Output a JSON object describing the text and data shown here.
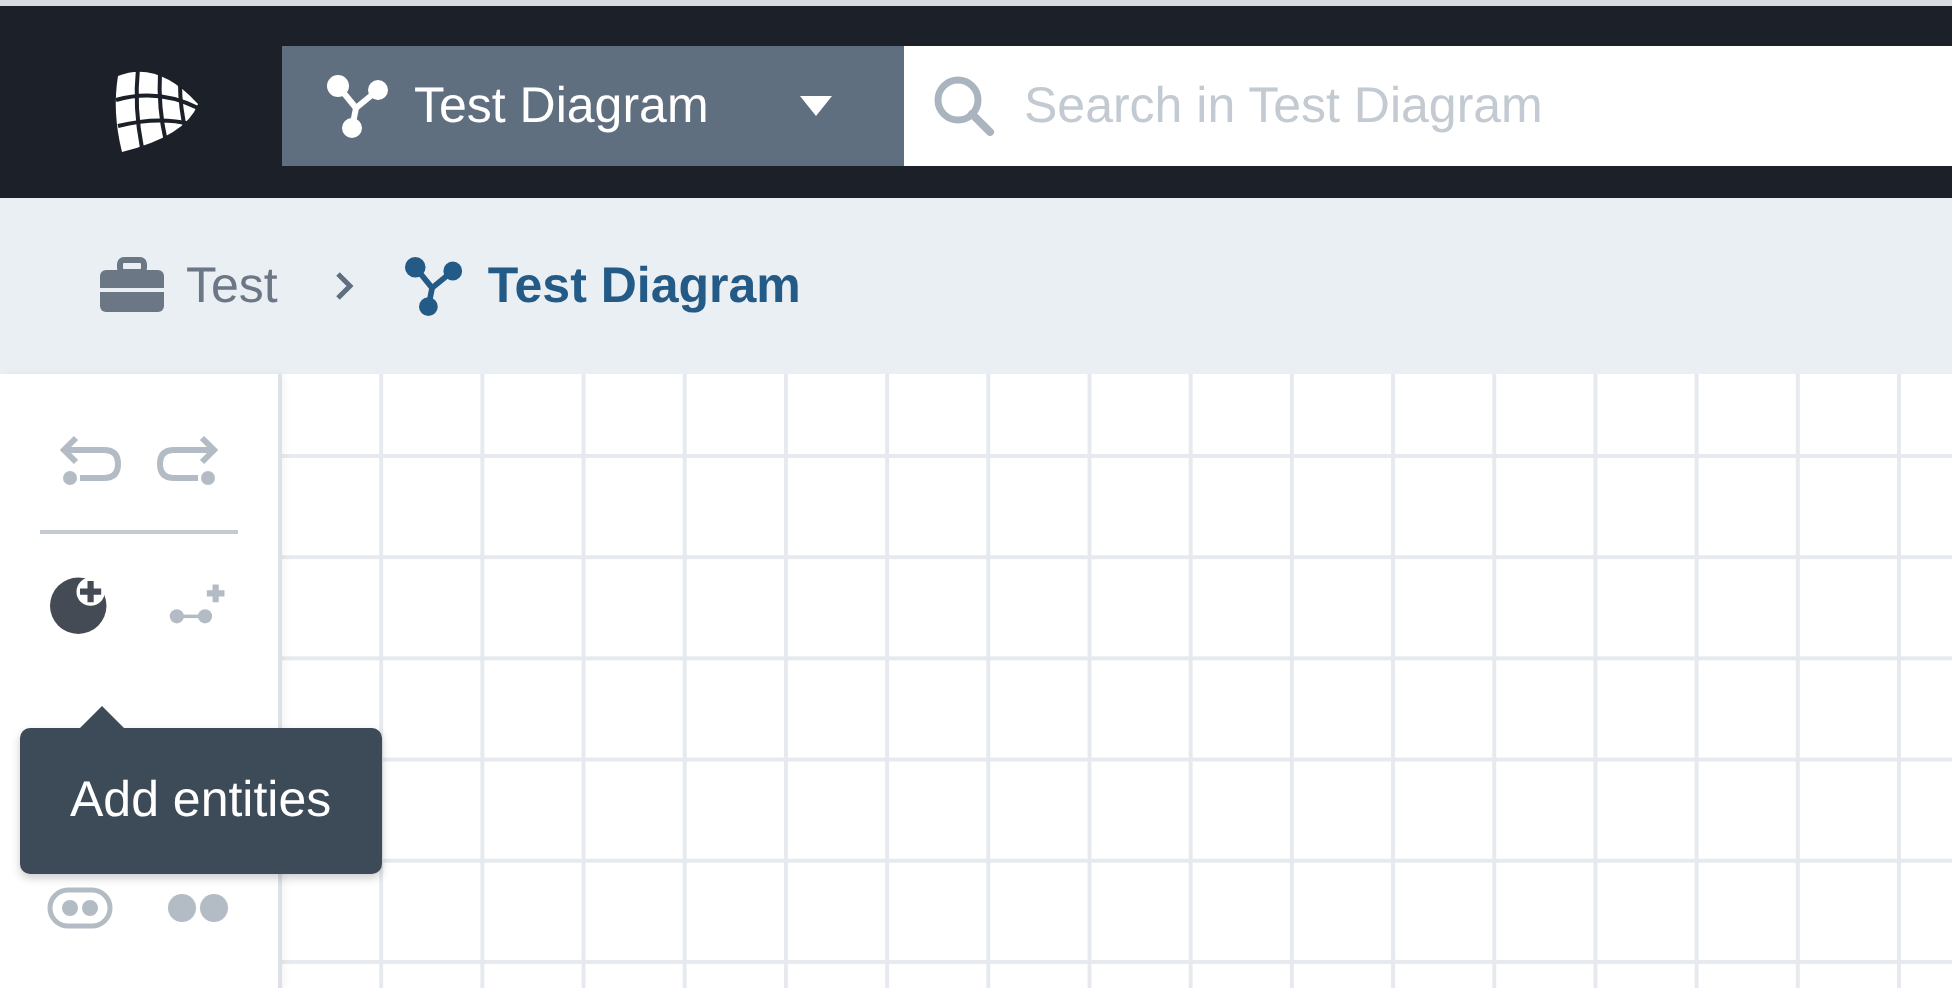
{
  "diagram_selector": {
    "label": "Test Diagram"
  },
  "search": {
    "placeholder": "Search in Test Diagram"
  },
  "breadcrumb": [
    {
      "label": "Test",
      "kind": "project",
      "current": false
    },
    {
      "label": "Test Diagram",
      "kind": "diagram",
      "current": true
    }
  ],
  "toolbar": {
    "groups": [
      [
        {
          "kind": "undo",
          "active": false
        },
        {
          "kind": "redo",
          "active": false
        }
      ],
      [
        {
          "kind": "add-entity",
          "active": true
        },
        {
          "kind": "add-link",
          "active": false
        }
      ],
      [
        {
          "kind": "toggle",
          "active": false
        },
        {
          "kind": "dots",
          "active": false
        }
      ]
    ]
  },
  "tooltip": {
    "text": "Add entities"
  }
}
